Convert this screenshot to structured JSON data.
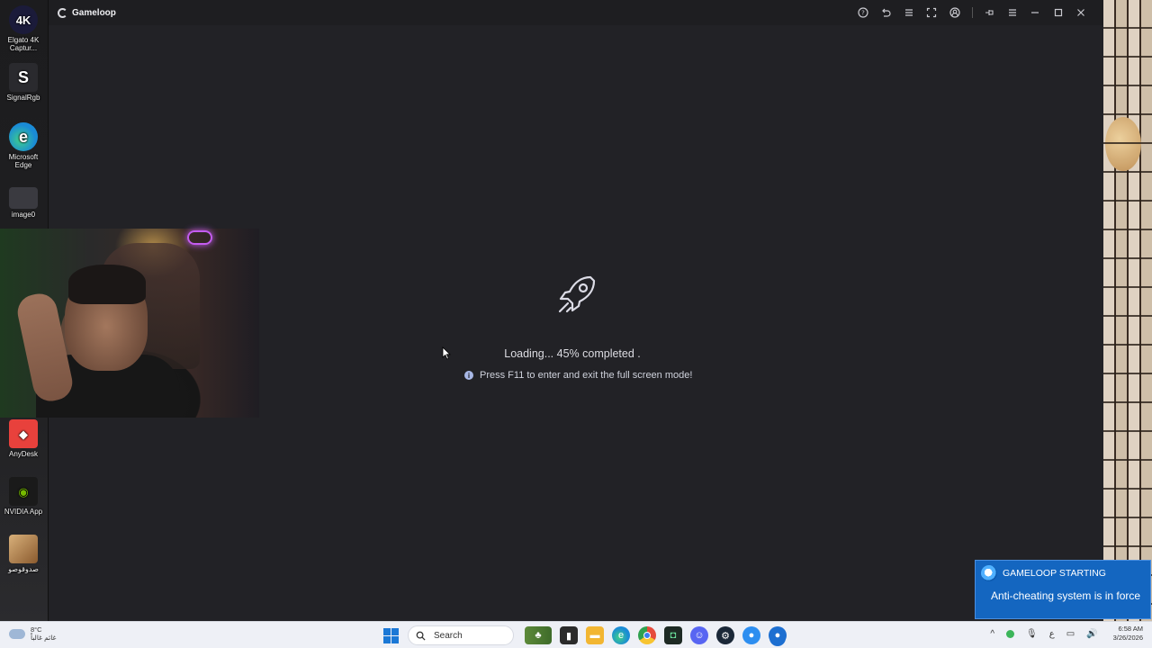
{
  "window": {
    "title": "Gameloop",
    "controls": [
      "help-icon",
      "undo-icon",
      "list-icon",
      "fullscreen-icon",
      "account-icon",
      "pin-icon",
      "menu-icon",
      "minimize-icon",
      "maximize-icon",
      "close-icon"
    ]
  },
  "loading": {
    "text": "Loading... 45% completed .",
    "progress_percent": 45,
    "hint": "Press F11 to enter and exit the full screen mode!"
  },
  "desktop_icons": [
    {
      "label": "Elgato 4K Captur...",
      "icon": "elgato-icon",
      "badge": "4K",
      "color": "#1b1b3a"
    },
    {
      "label": "SignalRgb",
      "icon": "signalrgb-icon",
      "badge": "S",
      "color": "#2a2a2e"
    },
    {
      "label": "Microsoft Edge",
      "icon": "edge-icon",
      "badge": "e",
      "color": "#1a8bd6"
    },
    {
      "label": "image0",
      "icon": "image-icon",
      "badge": "",
      "color": "#3a3a40"
    },
    {
      "label": "AnyDesk",
      "icon": "anydesk-icon",
      "badge": "◆",
      "color": "#e8413c"
    },
    {
      "label": "NVIDIA App",
      "icon": "nvidia-icon",
      "badge": "◉",
      "color": "#3f7d1c"
    },
    {
      "label": "صدوقوصو",
      "icon": "photo-icon",
      "badge": "",
      "color": "#b08a5a"
    }
  ],
  "toast": {
    "app": "GAMELOOP STARTING",
    "message": "Anti-cheating system is in force"
  },
  "taskbar": {
    "weather_temp": "8°C",
    "weather_desc": "غائم غالباً",
    "search_placeholder": "Search",
    "apps": [
      {
        "icon": "widgets-icon",
        "color": "#6b8f3a"
      },
      {
        "icon": "terminal-icon",
        "color": "#2b2b2b"
      },
      {
        "icon": "file-explorer-icon",
        "color": "#f2b632"
      },
      {
        "icon": "edge-icon",
        "color": "#1a8bd6"
      },
      {
        "icon": "chrome-icon",
        "color": "#e64a3b"
      },
      {
        "icon": "app-green-icon",
        "color": "#1e2a24"
      },
      {
        "icon": "discord-icon",
        "color": "#5865f2"
      },
      {
        "icon": "steam-icon",
        "color": "#1b2838"
      },
      {
        "icon": "gameloop-icon",
        "color": "#2d8ef0"
      },
      {
        "icon": "gameloop-active-icon",
        "color": "#1d6fd1"
      }
    ],
    "language": "ع",
    "time": "6:58 AM",
    "date": "3/26/2026"
  }
}
